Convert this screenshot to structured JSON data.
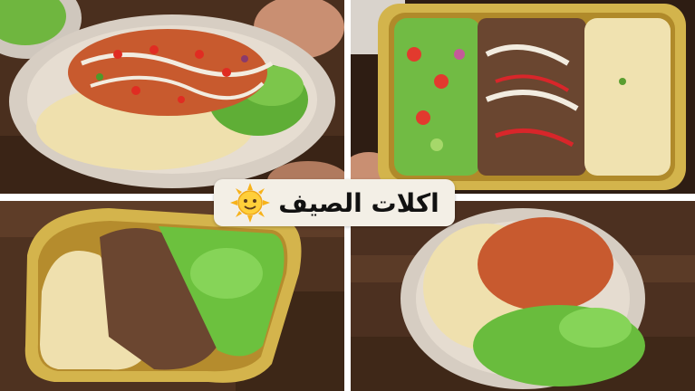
{
  "banner": {
    "title": "اكلات الصيف",
    "emoji": "sun-smiley-icon"
  },
  "colors": {
    "wood": "#5a3a24",
    "rice": "#efe0b0",
    "lettuce": "#67b93a",
    "chicken": "#c8582c",
    "beef": "#6b4a33",
    "sauce": "#f2ece0",
    "tray_gold": "#d2b24a",
    "plate": "#d8cfc4",
    "banner_bg": "#f3efe6"
  },
  "panels": [
    {
      "id": "top-left",
      "dish": "plate-chicken-rice-salad"
    },
    {
      "id": "top-right",
      "dish": "tray-beef-rice-salad"
    },
    {
      "id": "bottom-left",
      "dish": "tray-beef-rice-lettuce"
    },
    {
      "id": "bottom-right",
      "dish": "plate-chicken-rice-lettuce"
    }
  ]
}
